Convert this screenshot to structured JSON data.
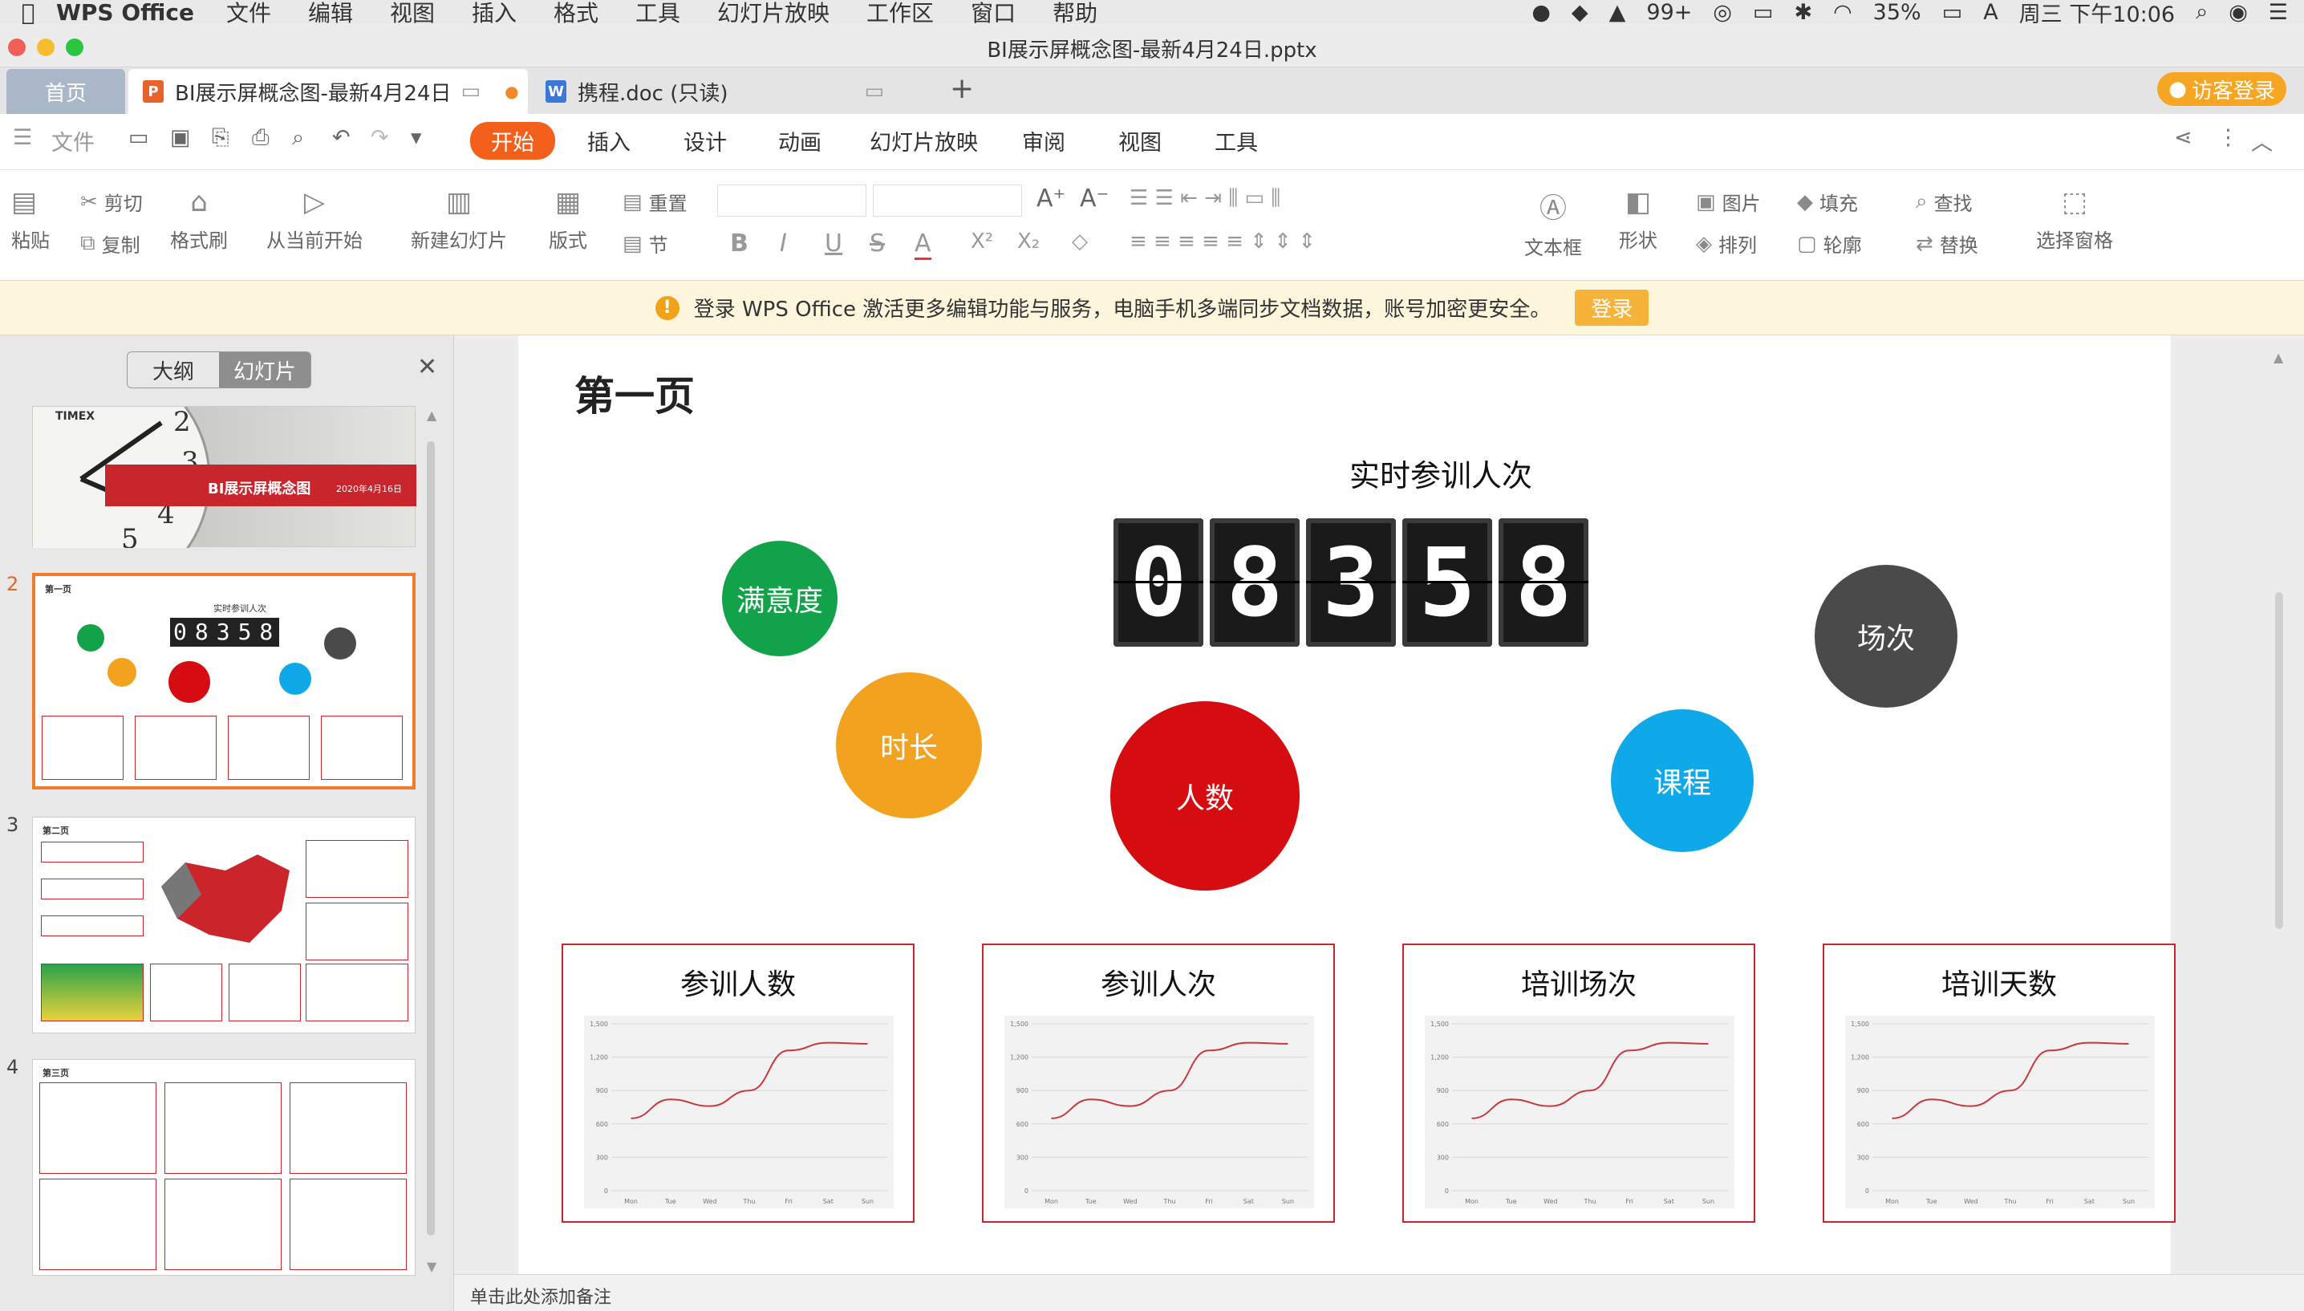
{
  "macmenu": {
    "app": "WPS Office",
    "items": [
      "文件",
      "编辑",
      "视图",
      "插入",
      "格式",
      "工具",
      "幻灯片放映",
      "工作区",
      "窗口",
      "帮助"
    ],
    "status": {
      "badge": "99+",
      "battery": "35%",
      "input": "A",
      "clock": "周三 下午10:06"
    }
  },
  "window": {
    "title": "BI展示屏概念图-最新4月24日.pptx"
  },
  "tabs": {
    "home": "首页",
    "doc1": "BI展示屏概念图-最新4月24日",
    "doc2": "携程.doc (只读)",
    "guest": "访客登录"
  },
  "ribbon": {
    "file": "文件",
    "tabs": [
      "开始",
      "插入",
      "设计",
      "动画",
      "幻灯片放映",
      "审阅",
      "视图",
      "工具"
    ]
  },
  "toolbar": {
    "paste": "粘贴",
    "cut": "剪切",
    "copy": "复制",
    "format_painter": "格式刷",
    "from_current": "从当前开始",
    "new_slide": "新建幻灯片",
    "layout": "版式",
    "reset": "重置",
    "section": "节",
    "textbox": "文本框",
    "shape": "形状",
    "picture": "图片",
    "arrange": "排列",
    "fill": "填充",
    "outline": "轮廓",
    "find": "查找",
    "replace": "替换",
    "select_pane": "选择窗格"
  },
  "banner": {
    "text": "登录 WPS Office 激活更多编辑功能与服务，电脑手机多端同步文档数据，账号加密更安全。",
    "button": "登录"
  },
  "sidebar": {
    "outline": "大纲",
    "slides": "幻灯片",
    "numbers": [
      "2",
      "3",
      "4"
    ],
    "slide1": {
      "brand": "TIMEX",
      "title": "BI展示屏概念图",
      "date": "2020年4月16日"
    },
    "slide3_title": "第二页",
    "slide4_title": "第三页"
  },
  "slide": {
    "title": "第一页",
    "counter_label": "实时参训人次",
    "digits": [
      "0",
      "8",
      "3",
      "5",
      "8"
    ],
    "bubbles": {
      "satisfaction": "满意度",
      "duration": "时长",
      "people": "人数",
      "course": "课程",
      "sessions": "场次"
    },
    "colors": {
      "satisfaction": "#12a24a",
      "duration": "#f2a21f",
      "people": "#d50d10",
      "course": "#0fa8e8",
      "sessions": "#4a4a4a",
      "card_border": "#c9252b"
    },
    "cards": [
      "参训人数",
      "参训人次",
      "培训场次",
      "培训天数"
    ]
  },
  "chart_data": {
    "type": "line",
    "categories": [
      "Mon",
      "Tue",
      "Wed",
      "Thu",
      "Fri",
      "Sat",
      "Sun"
    ],
    "series": [
      {
        "values": [
          650,
          820,
          760,
          900,
          1260,
          1330,
          1320
        ]
      }
    ],
    "ylim": [
      0,
      1500
    ],
    "yticks": [
      0,
      300,
      600,
      900,
      1200,
      1500
    ],
    "grid": true
  },
  "notes": "单击此处添加备注"
}
